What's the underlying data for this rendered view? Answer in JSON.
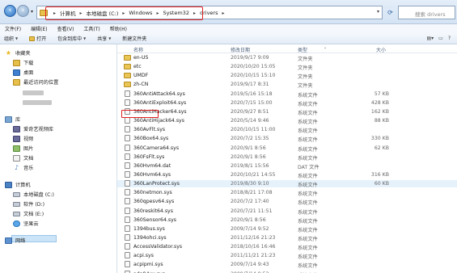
{
  "address": {
    "crumbs": [
      "计算机",
      "本地磁盘 (C:)",
      "Windows",
      "System32",
      "drivers"
    ],
    "separator": "▸",
    "search_placeholder": "搜索 drivers"
  },
  "menu": [
    "文件(F)",
    "编辑(E)",
    "查看(V)",
    "工具(T)",
    "帮助(H)"
  ],
  "commands": {
    "organize": "组织",
    "open": "打开",
    "include": "包含到库中",
    "share": "共享",
    "new_folder": "新建文件夹"
  },
  "nav": {
    "favorites": "收藏夹",
    "downloads": "下载",
    "desktop": "桌面",
    "recent": "最近访问的位置",
    "libraries": "库",
    "aiqiyi": "爱奇艺视频库",
    "videos": "视频",
    "pictures": "图片",
    "documents": "文档",
    "music": "音乐",
    "computer": "计算机",
    "drive_c": "本地磁盘 (C:)",
    "drive_d": "软件 (D:)",
    "drive_e": "文档 (E:)",
    "cloud": "坚果云",
    "network": "网络"
  },
  "columns": {
    "name": "名称",
    "date": "修改日期",
    "type": "类型",
    "size": "大小"
  },
  "files": [
    {
      "name": "en-US",
      "date": "2019/9/17 9:09",
      "type": "文件夹",
      "size": "",
      "kind": "folder"
    },
    {
      "name": "etc",
      "date": "2020/10/20 15:05",
      "type": "文件夹",
      "size": "",
      "kind": "folder"
    },
    {
      "name": "UMDF",
      "date": "2020/10/15 15:10",
      "type": "文件夹",
      "size": "",
      "kind": "folder"
    },
    {
      "name": "zh-CN",
      "date": "2019/9/17 8:31",
      "type": "文件夹",
      "size": "",
      "kind": "folder"
    },
    {
      "name": "360AntiAttack64.sys",
      "date": "2019/5/16 15:18",
      "type": "系统文件",
      "size": "57 KB",
      "kind": "file"
    },
    {
      "name": "360AntiExploit64.sys",
      "date": "2020/7/15 15:00",
      "type": "系统文件",
      "size": "428 KB",
      "kind": "file"
    },
    {
      "name": "360AntiHacker64.sys",
      "date": "2020/9/27 8:51",
      "type": "系统文件",
      "size": "162 KB",
      "kind": "file"
    },
    {
      "name": "360AntiHijack64.sys",
      "date": "2020/5/14 9:46",
      "type": "系统文件",
      "size": "88 KB",
      "kind": "file"
    },
    {
      "name": "360AvFlt.sys",
      "date": "2020/10/15 11:00",
      "type": "系统文件",
      "size": "",
      "kind": "file"
    },
    {
      "name": "360Box64.sys",
      "date": "2020/7/2 15:35",
      "type": "系统文件",
      "size": "330 KB",
      "kind": "file"
    },
    {
      "name": "360Camera64.sys",
      "date": "2020/9/1 8:56",
      "type": "系统文件",
      "size": "62 KB",
      "kind": "file"
    },
    {
      "name": "360FsFlt.sys",
      "date": "2020/9/1 8:56",
      "type": "系统文件",
      "size": "",
      "kind": "file"
    },
    {
      "name": "360Hvm64.dat",
      "date": "2019/8/1 15:56",
      "type": "DAT 文件",
      "size": "",
      "kind": "file"
    },
    {
      "name": "360Hvm64.sys",
      "date": "2020/10/21 14:55",
      "type": "系统文件",
      "size": "316 KB",
      "kind": "file"
    },
    {
      "name": "360LanProtect.sys",
      "date": "2019/8/30 9:10",
      "type": "系统文件",
      "size": "60 KB",
      "kind": "file"
    },
    {
      "name": "360netmon.sys",
      "date": "2018/8/21 17:08",
      "type": "系统文件",
      "size": "",
      "kind": "file"
    },
    {
      "name": "360qpesv64.sys",
      "date": "2020/7/2 17:40",
      "type": "系统文件",
      "size": "",
      "kind": "file"
    },
    {
      "name": "360reskit64.sys",
      "date": "2020/7/21 11:51",
      "type": "系统文件",
      "size": "",
      "kind": "file"
    },
    {
      "name": "360Sensor64.sys",
      "date": "2020/9/1 8:56",
      "type": "系统文件",
      "size": "",
      "kind": "file"
    },
    {
      "name": "1394bus.sys",
      "date": "2009/7/14 9:52",
      "type": "系统文件",
      "size": "",
      "kind": "file"
    },
    {
      "name": "1394ohci.sys",
      "date": "2011/12/16 21:23",
      "type": "系统文件",
      "size": "",
      "kind": "file"
    },
    {
      "name": "AccessValidator.sys",
      "date": "2018/10/16 16:46",
      "type": "系统文件",
      "size": "",
      "kind": "file"
    },
    {
      "name": "acpi.sys",
      "date": "2011/11/21 21:23",
      "type": "系统文件",
      "size": "",
      "kind": "file"
    },
    {
      "name": "acpipmi.sys",
      "date": "2009/7/14 9:43",
      "type": "系统文件",
      "size": "",
      "kind": "file"
    },
    {
      "name": "adp94xx.sys",
      "date": "2009/7/14 9:52",
      "type": "系统文件",
      "size": "",
      "kind": "file"
    }
  ]
}
